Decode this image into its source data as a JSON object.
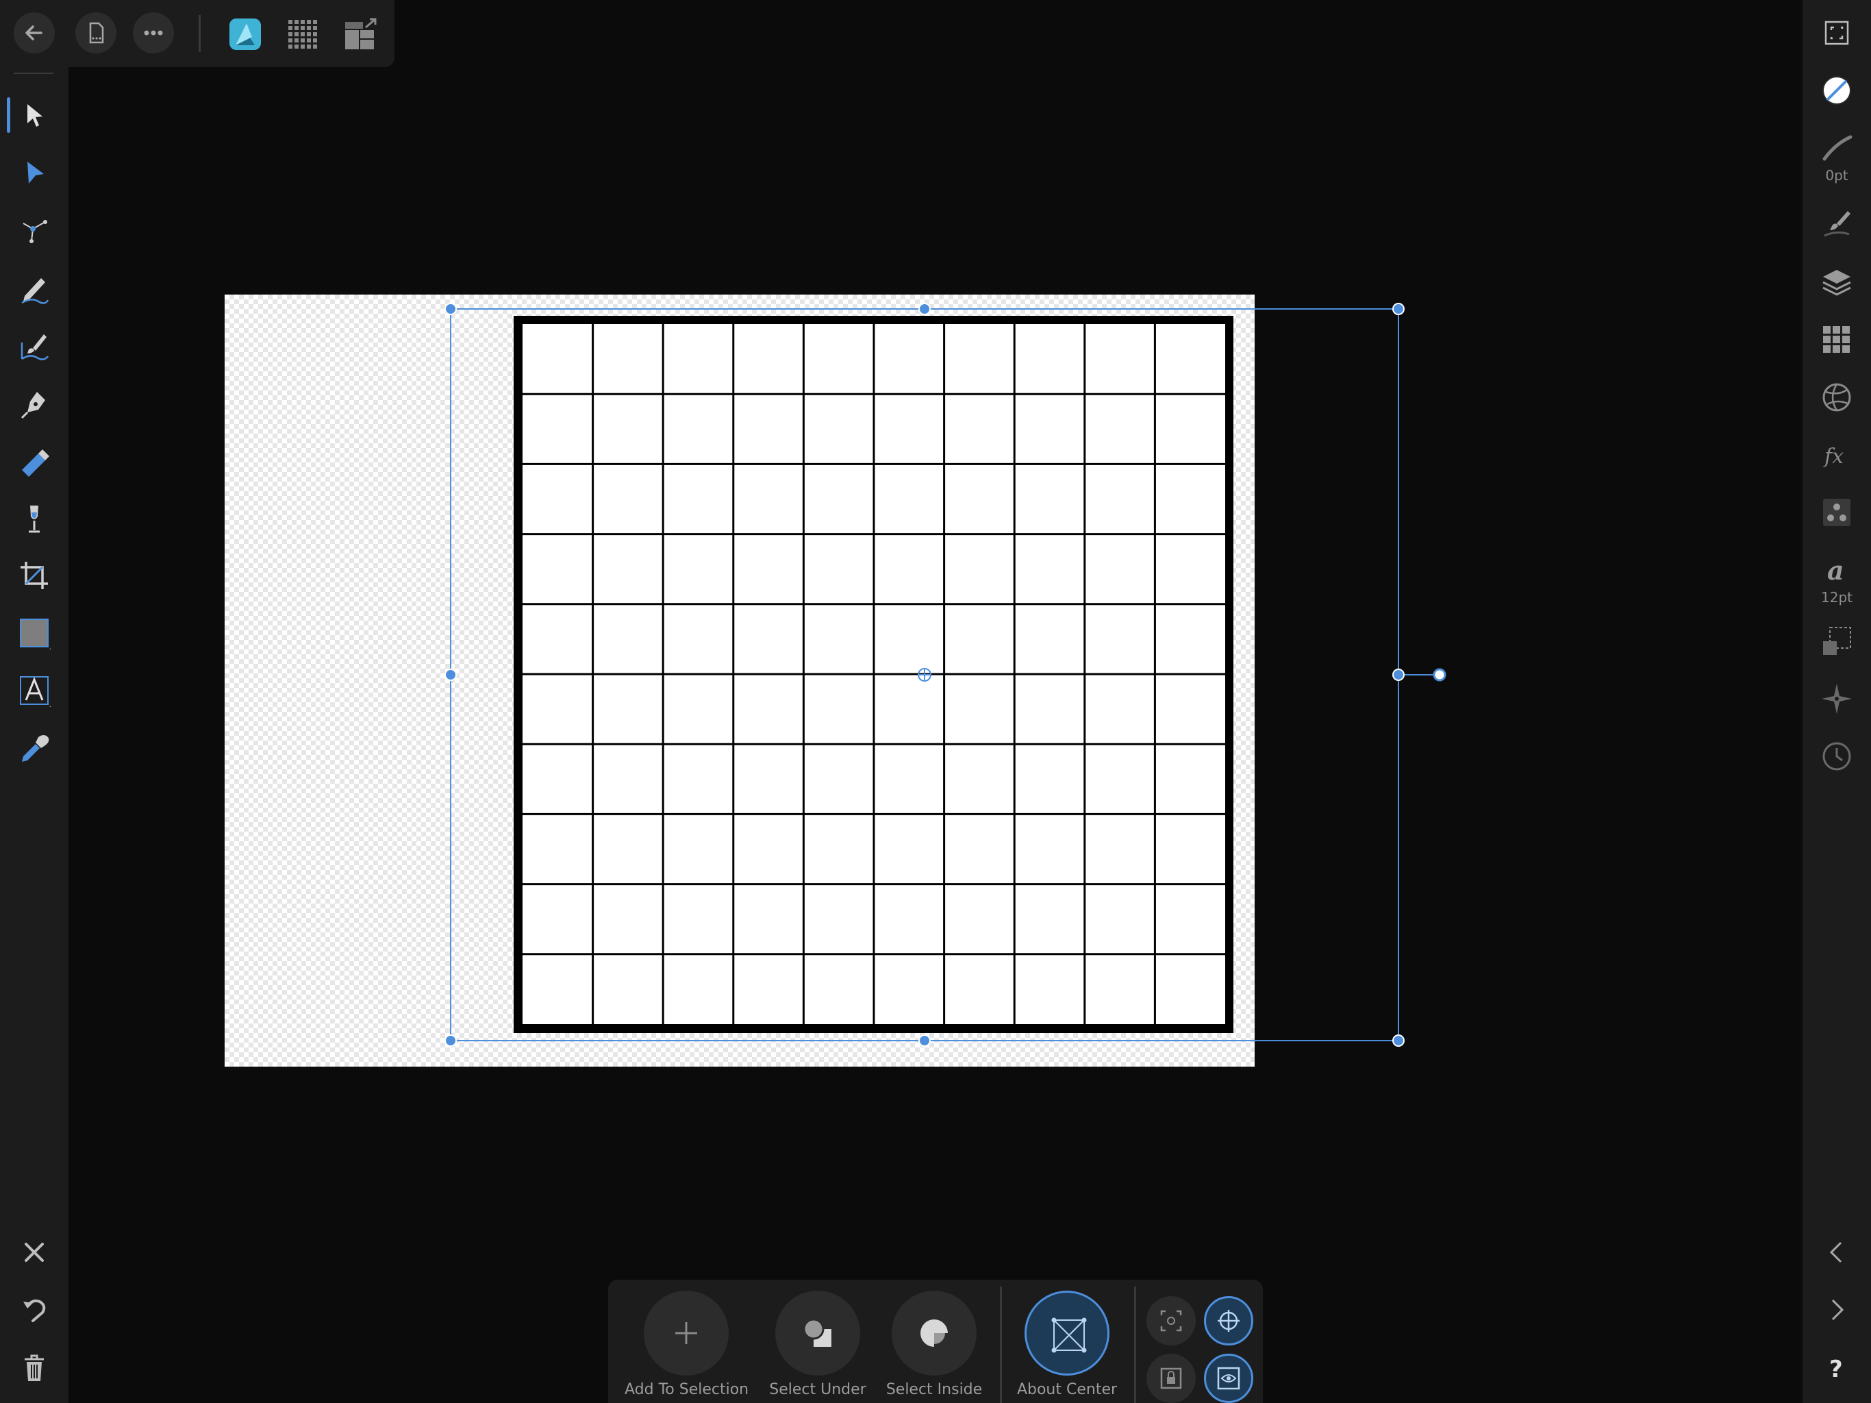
{
  "app": {
    "accent_color": "#4d8fdc",
    "panel_color": "#1c1c1c",
    "background_color": "#0b0b0b"
  },
  "top_toolbar": {
    "buttons": [
      "back-arrow-icon",
      "document-menu-icon",
      "more-options-icon"
    ],
    "personas": [
      "designer-persona-icon",
      "pixel-persona-icon",
      "export-persona-icon"
    ]
  },
  "left_toolbar": {
    "tools": [
      "move-tool-icon",
      "node-tool-icon",
      "corner-tool-icon",
      "pencil-tool-icon",
      "vector-brush-tool-icon",
      "pen-tool-icon",
      "fill-tool-icon",
      "transparency-tool-icon",
      "crop-tool-icon",
      "rectangle-tool-icon",
      "text-tool-icon",
      "color-picker-tool-icon"
    ],
    "bottom_actions": [
      "close-icon",
      "undo-icon",
      "delete-icon"
    ]
  },
  "right_studio": {
    "stroke_width_label": "0pt",
    "font_size_label": "12pt",
    "panels": [
      "view-fullscreen-icon",
      "color-icon",
      "stroke-icon",
      "brushes-icon",
      "layers-icon",
      "swatches-icon",
      "adjustments-icon",
      "effects-icon",
      "styles-icon",
      "text-styles-icon",
      "transform-icon",
      "navigator-icon",
      "history-icon"
    ],
    "navigation": [
      "previous-icon",
      "next-icon",
      "help-icon"
    ]
  },
  "canvas": {
    "grid_columns": 10,
    "grid_rows": 10
  },
  "context_toolbar": {
    "add_to_selection": "Add To Selection",
    "select_under": "Select Under",
    "select_inside": "Select Inside",
    "about_center": "About Center"
  }
}
